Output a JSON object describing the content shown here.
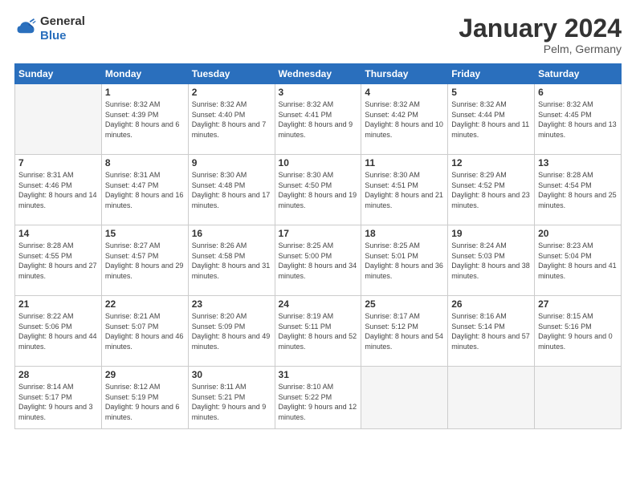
{
  "header": {
    "logo_general": "General",
    "logo_blue": "Blue",
    "title": "January 2024",
    "location": "Pelm, Germany"
  },
  "calendar": {
    "days_of_week": [
      "Sunday",
      "Monday",
      "Tuesday",
      "Wednesday",
      "Thursday",
      "Friday",
      "Saturday"
    ],
    "weeks": [
      [
        {
          "day": null,
          "info": null
        },
        {
          "day": "1",
          "sunrise": "Sunrise: 8:32 AM",
          "sunset": "Sunset: 4:39 PM",
          "daylight": "Daylight: 8 hours and 6 minutes."
        },
        {
          "day": "2",
          "sunrise": "Sunrise: 8:32 AM",
          "sunset": "Sunset: 4:40 PM",
          "daylight": "Daylight: 8 hours and 7 minutes."
        },
        {
          "day": "3",
          "sunrise": "Sunrise: 8:32 AM",
          "sunset": "Sunset: 4:41 PM",
          "daylight": "Daylight: 8 hours and 9 minutes."
        },
        {
          "day": "4",
          "sunrise": "Sunrise: 8:32 AM",
          "sunset": "Sunset: 4:42 PM",
          "daylight": "Daylight: 8 hours and 10 minutes."
        },
        {
          "day": "5",
          "sunrise": "Sunrise: 8:32 AM",
          "sunset": "Sunset: 4:44 PM",
          "daylight": "Daylight: 8 hours and 11 minutes."
        },
        {
          "day": "6",
          "sunrise": "Sunrise: 8:32 AM",
          "sunset": "Sunset: 4:45 PM",
          "daylight": "Daylight: 8 hours and 13 minutes."
        }
      ],
      [
        {
          "day": "7",
          "sunrise": "Sunrise: 8:31 AM",
          "sunset": "Sunset: 4:46 PM",
          "daylight": "Daylight: 8 hours and 14 minutes."
        },
        {
          "day": "8",
          "sunrise": "Sunrise: 8:31 AM",
          "sunset": "Sunset: 4:47 PM",
          "daylight": "Daylight: 8 hours and 16 minutes."
        },
        {
          "day": "9",
          "sunrise": "Sunrise: 8:30 AM",
          "sunset": "Sunset: 4:48 PM",
          "daylight": "Daylight: 8 hours and 17 minutes."
        },
        {
          "day": "10",
          "sunrise": "Sunrise: 8:30 AM",
          "sunset": "Sunset: 4:50 PM",
          "daylight": "Daylight: 8 hours and 19 minutes."
        },
        {
          "day": "11",
          "sunrise": "Sunrise: 8:30 AM",
          "sunset": "Sunset: 4:51 PM",
          "daylight": "Daylight: 8 hours and 21 minutes."
        },
        {
          "day": "12",
          "sunrise": "Sunrise: 8:29 AM",
          "sunset": "Sunset: 4:52 PM",
          "daylight": "Daylight: 8 hours and 23 minutes."
        },
        {
          "day": "13",
          "sunrise": "Sunrise: 8:28 AM",
          "sunset": "Sunset: 4:54 PM",
          "daylight": "Daylight: 8 hours and 25 minutes."
        }
      ],
      [
        {
          "day": "14",
          "sunrise": "Sunrise: 8:28 AM",
          "sunset": "Sunset: 4:55 PM",
          "daylight": "Daylight: 8 hours and 27 minutes."
        },
        {
          "day": "15",
          "sunrise": "Sunrise: 8:27 AM",
          "sunset": "Sunset: 4:57 PM",
          "daylight": "Daylight: 8 hours and 29 minutes."
        },
        {
          "day": "16",
          "sunrise": "Sunrise: 8:26 AM",
          "sunset": "Sunset: 4:58 PM",
          "daylight": "Daylight: 8 hours and 31 minutes."
        },
        {
          "day": "17",
          "sunrise": "Sunrise: 8:25 AM",
          "sunset": "Sunset: 5:00 PM",
          "daylight": "Daylight: 8 hours and 34 minutes."
        },
        {
          "day": "18",
          "sunrise": "Sunrise: 8:25 AM",
          "sunset": "Sunset: 5:01 PM",
          "daylight": "Daylight: 8 hours and 36 minutes."
        },
        {
          "day": "19",
          "sunrise": "Sunrise: 8:24 AM",
          "sunset": "Sunset: 5:03 PM",
          "daylight": "Daylight: 8 hours and 38 minutes."
        },
        {
          "day": "20",
          "sunrise": "Sunrise: 8:23 AM",
          "sunset": "Sunset: 5:04 PM",
          "daylight": "Daylight: 8 hours and 41 minutes."
        }
      ],
      [
        {
          "day": "21",
          "sunrise": "Sunrise: 8:22 AM",
          "sunset": "Sunset: 5:06 PM",
          "daylight": "Daylight: 8 hours and 44 minutes."
        },
        {
          "day": "22",
          "sunrise": "Sunrise: 8:21 AM",
          "sunset": "Sunset: 5:07 PM",
          "daylight": "Daylight: 8 hours and 46 minutes."
        },
        {
          "day": "23",
          "sunrise": "Sunrise: 8:20 AM",
          "sunset": "Sunset: 5:09 PM",
          "daylight": "Daylight: 8 hours and 49 minutes."
        },
        {
          "day": "24",
          "sunrise": "Sunrise: 8:19 AM",
          "sunset": "Sunset: 5:11 PM",
          "daylight": "Daylight: 8 hours and 52 minutes."
        },
        {
          "day": "25",
          "sunrise": "Sunrise: 8:17 AM",
          "sunset": "Sunset: 5:12 PM",
          "daylight": "Daylight: 8 hours and 54 minutes."
        },
        {
          "day": "26",
          "sunrise": "Sunrise: 8:16 AM",
          "sunset": "Sunset: 5:14 PM",
          "daylight": "Daylight: 8 hours and 57 minutes."
        },
        {
          "day": "27",
          "sunrise": "Sunrise: 8:15 AM",
          "sunset": "Sunset: 5:16 PM",
          "daylight": "Daylight: 9 hours and 0 minutes."
        }
      ],
      [
        {
          "day": "28",
          "sunrise": "Sunrise: 8:14 AM",
          "sunset": "Sunset: 5:17 PM",
          "daylight": "Daylight: 9 hours and 3 minutes."
        },
        {
          "day": "29",
          "sunrise": "Sunrise: 8:12 AM",
          "sunset": "Sunset: 5:19 PM",
          "daylight": "Daylight: 9 hours and 6 minutes."
        },
        {
          "day": "30",
          "sunrise": "Sunrise: 8:11 AM",
          "sunset": "Sunset: 5:21 PM",
          "daylight": "Daylight: 9 hours and 9 minutes."
        },
        {
          "day": "31",
          "sunrise": "Sunrise: 8:10 AM",
          "sunset": "Sunset: 5:22 PM",
          "daylight": "Daylight: 9 hours and 12 minutes."
        },
        {
          "day": null,
          "info": null
        },
        {
          "day": null,
          "info": null
        },
        {
          "day": null,
          "info": null
        }
      ]
    ]
  }
}
